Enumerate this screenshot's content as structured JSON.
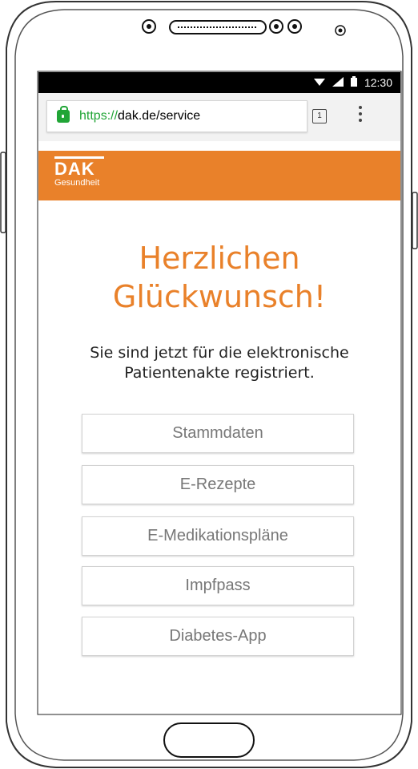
{
  "status_bar": {
    "time": "12:30"
  },
  "browser": {
    "url_scheme": "https://",
    "url_rest": "dak.de/service",
    "tab_count": "1"
  },
  "brand": {
    "logo": "DAK",
    "subtitle": "Gesundheit"
  },
  "content": {
    "headline_line1": "Herzlichen",
    "headline_line2": "Glückwunsch!",
    "subtext_line1": "Sie sind jetzt für die elektronische",
    "subtext_line2": "Patientenakte registriert.",
    "buttons": [
      "Stammdaten",
      "E-Rezepte",
      "E-Medikationspläne",
      "Impfpass",
      "Diabetes-App"
    ]
  },
  "colors": {
    "accent": "#e9812a",
    "secure": "#21a536"
  }
}
